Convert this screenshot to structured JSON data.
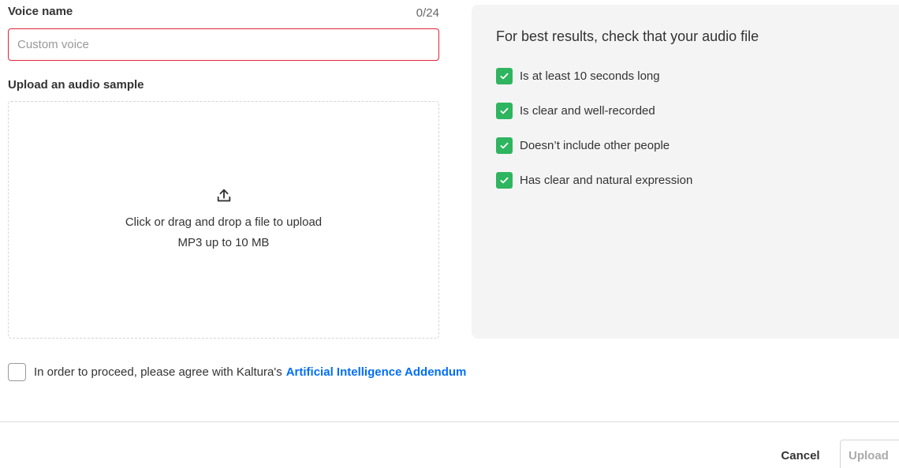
{
  "voice_name": {
    "label": "Voice name",
    "counter": "0/24",
    "value": "",
    "placeholder": "Custom voice"
  },
  "upload": {
    "label": "Upload an audio sample",
    "icon": "upload-icon",
    "instruction": "Click or drag and drop a file to upload",
    "limits": "MP3 up to 10 MB"
  },
  "tips": {
    "title": "For best results, check that your audio file",
    "items": [
      {
        "label": "Is at least 10 seconds long",
        "checked": true
      },
      {
        "label": "Is clear and well-recorded",
        "checked": true
      },
      {
        "label": "Doesn’t include other people",
        "checked": true
      },
      {
        "label": "Has clear and natural expression",
        "checked": true
      }
    ],
    "check_color": "#2fb55f"
  },
  "agreement": {
    "checked": false,
    "text": "In order to proceed, please agree with Kaltura's",
    "link_text": "Artificial Intelligence Addendum",
    "link_color": "#006efa"
  },
  "footer": {
    "cancel_label": "Cancel",
    "upload_label": "Upload"
  },
  "colors": {
    "input_error_border": "#e12437",
    "panel_background": "#f4f4f4"
  }
}
